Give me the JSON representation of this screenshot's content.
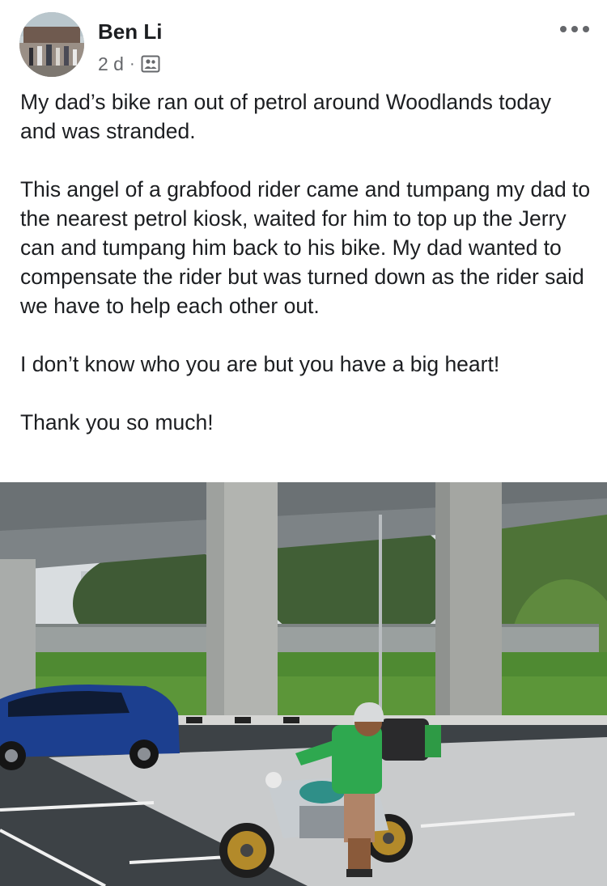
{
  "post": {
    "author": "Ben Li",
    "timestamp": "2 d",
    "separator": "·",
    "audience_icon": "friends-icon",
    "more_icon": "more-horizontal-icon",
    "paragraphs": [
      "My dad’s bike ran out of petrol around Woodlands today and was stranded.",
      "This angel of a grabfood rider came and tumpang my dad to the nearest petrol kiosk, waited for him to top up the Jerry can and tumpang him back to his bike. My dad wanted to compensate the rider but was turned down as the rider said we have to help each other out.",
      "I don’t know who you are but you have a big heart!",
      "Thank you so much!"
    ],
    "photo_subject": "Grabfood rider in green jacket on a motorcycle under a flyover, blue car parked on left"
  },
  "colors": {
    "text_primary": "#1c1e21",
    "text_secondary": "#65676b",
    "grab_green": "#2ea84f"
  }
}
